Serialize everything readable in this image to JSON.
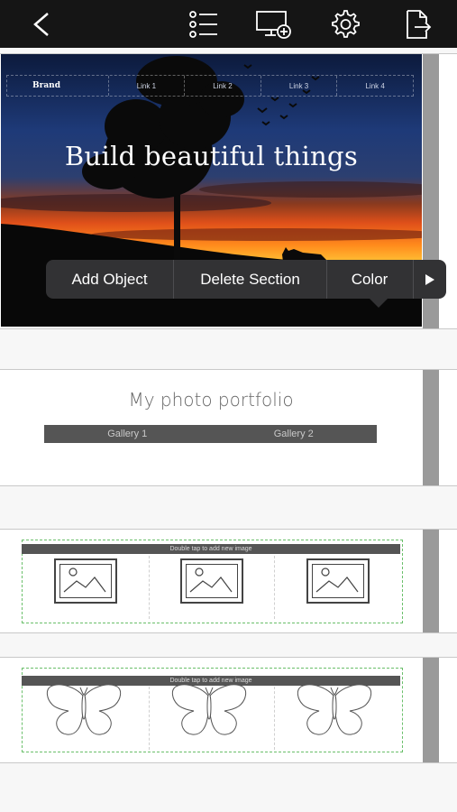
{
  "toolbar": {
    "icons": [
      "back-icon",
      "list-icon",
      "monitor-add-icon",
      "settings-gear-icon",
      "export-icon"
    ]
  },
  "hero": {
    "nav": {
      "brand": "Brand",
      "links": [
        "Link 1",
        "Link 2",
        "Link 3",
        "Link 4"
      ]
    },
    "title": "Build beautiful things"
  },
  "context_menu": {
    "items": [
      "Add Object",
      "Delete Section",
      "Color"
    ],
    "more_icon": "play-right-icon"
  },
  "portfolio": {
    "title": "My photo portfolio",
    "galleries": [
      "Gallery 1",
      "Gallery 2"
    ]
  },
  "image_grid": {
    "hint": "Double tap to add new image"
  },
  "butterfly_grid": {
    "hint": "Double tap to add new image"
  },
  "colors": {
    "toolbar": "#151515",
    "menu": "#323234",
    "section_bar": "#555555",
    "guide": "#6abf6a"
  }
}
